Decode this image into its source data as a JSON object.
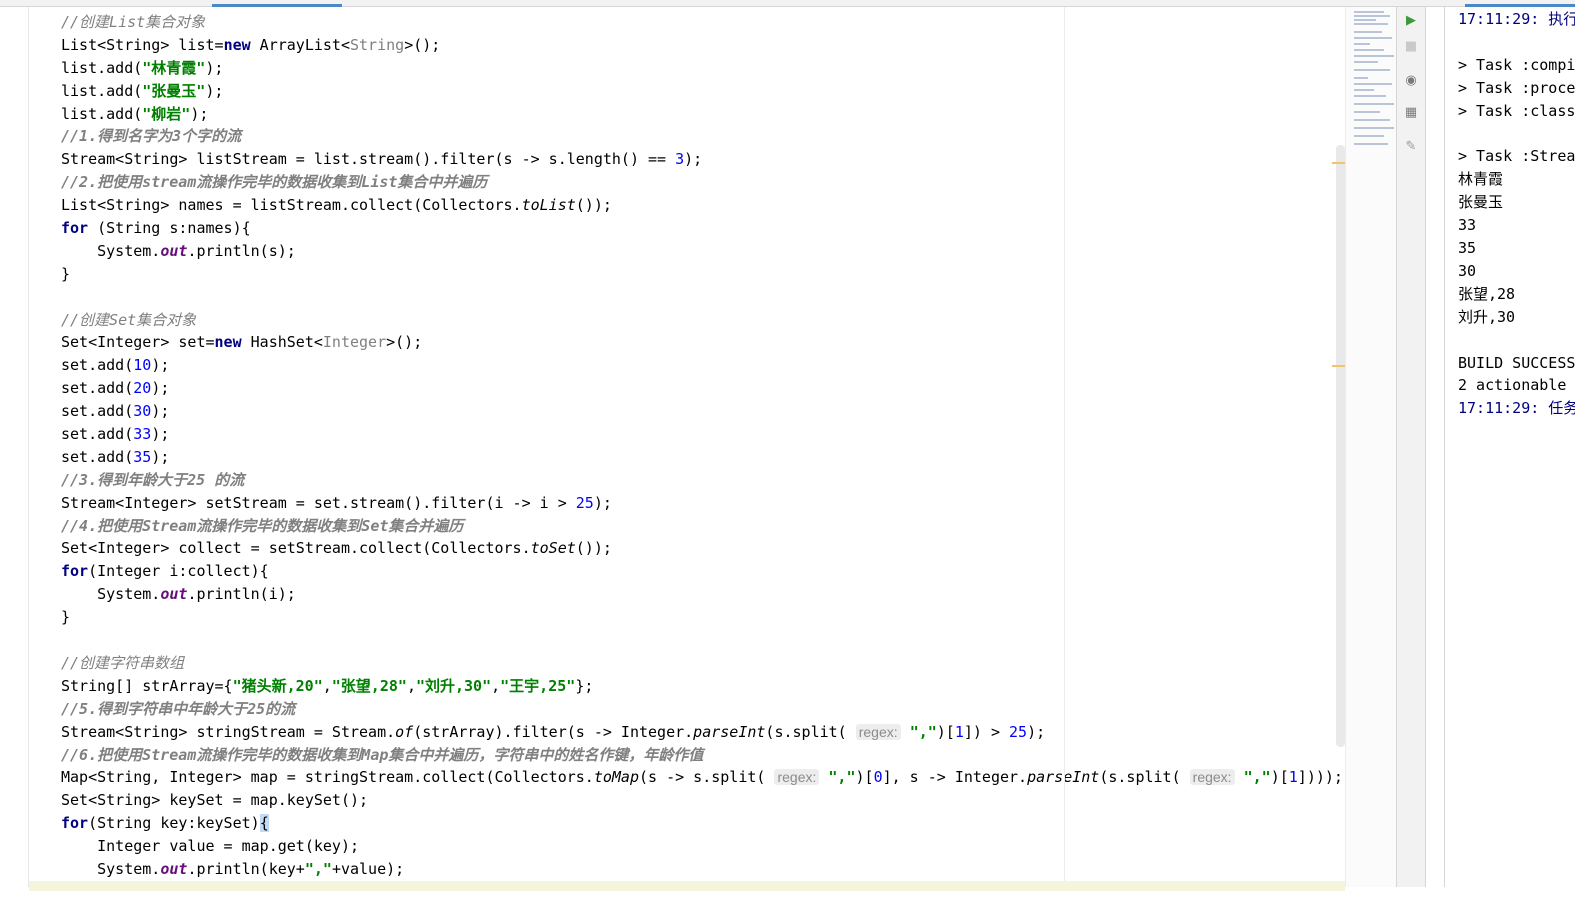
{
  "editor": {
    "lines": [
      {
        "s": [
          {
            "t": "//创建List集合对象",
            "c": "cm"
          }
        ]
      },
      {
        "s": [
          {
            "t": "List<String> list="
          },
          {
            "t": "new",
            "c": "kw"
          },
          {
            "t": " ArrayList<"
          },
          {
            "t": "String",
            "c": "gen"
          },
          {
            "t": ">();"
          }
        ]
      },
      {
        "s": [
          {
            "t": "list.add("
          },
          {
            "t": "\"林青霞\"",
            "c": "str"
          },
          {
            "t": ");"
          }
        ]
      },
      {
        "s": [
          {
            "t": "list.add("
          },
          {
            "t": "\"张曼玉\"",
            "c": "str"
          },
          {
            "t": ");"
          }
        ]
      },
      {
        "s": [
          {
            "t": "list.add("
          },
          {
            "t": "\"柳岩\"",
            "c": "str"
          },
          {
            "t": ");"
          }
        ]
      },
      {
        "s": [
          {
            "t": "//1.得到名字为3个字的流",
            "c": "cmb"
          }
        ]
      },
      {
        "s": [
          {
            "t": "Stream<String> listStream = list.stream().filter(s -> s.length() == "
          },
          {
            "t": "3",
            "c": "num"
          },
          {
            "t": ");"
          }
        ]
      },
      {
        "s": [
          {
            "t": "//2.把使用stream流操作完毕的数据收集到List集合中并遍历",
            "c": "cmb"
          }
        ]
      },
      {
        "s": [
          {
            "t": "List<String> names = listStream.collect(Collectors."
          },
          {
            "t": "toList",
            "c": "it"
          },
          {
            "t": "());"
          }
        ]
      },
      {
        "s": [
          {
            "t": "for",
            "c": "kw"
          },
          {
            "t": " (String s:names){"
          }
        ]
      },
      {
        "s": [
          {
            "t": "    System."
          },
          {
            "t": "out",
            "c": "stat"
          },
          {
            "t": ".println(s);"
          }
        ]
      },
      {
        "s": [
          {
            "t": "}"
          }
        ]
      },
      {
        "s": []
      },
      {
        "s": [
          {
            "t": "//创建Set集合对象",
            "c": "cm"
          }
        ]
      },
      {
        "s": [
          {
            "t": "Set<Integer> set="
          },
          {
            "t": "new",
            "c": "kw"
          },
          {
            "t": " HashSet<"
          },
          {
            "t": "Integer",
            "c": "gen"
          },
          {
            "t": ">();"
          }
        ]
      },
      {
        "s": [
          {
            "t": "set.add("
          },
          {
            "t": "10",
            "c": "num"
          },
          {
            "t": ");"
          }
        ]
      },
      {
        "s": [
          {
            "t": "set.add("
          },
          {
            "t": "20",
            "c": "num"
          },
          {
            "t": ");"
          }
        ]
      },
      {
        "s": [
          {
            "t": "set.add("
          },
          {
            "t": "30",
            "c": "num"
          },
          {
            "t": ");"
          }
        ]
      },
      {
        "s": [
          {
            "t": "set.add("
          },
          {
            "t": "33",
            "c": "num"
          },
          {
            "t": ");"
          }
        ]
      },
      {
        "s": [
          {
            "t": "set.add("
          },
          {
            "t": "35",
            "c": "num"
          },
          {
            "t": ");"
          }
        ]
      },
      {
        "s": [
          {
            "t": "//3.得到年龄大于25 的流",
            "c": "cmb"
          }
        ]
      },
      {
        "s": [
          {
            "t": "Stream<Integer> setStream = set.stream().filter(i -> i > "
          },
          {
            "t": "25",
            "c": "num"
          },
          {
            "t": ");"
          }
        ]
      },
      {
        "s": [
          {
            "t": "//4.把使用Stream流操作完毕的数据收集到Set集合并遍历",
            "c": "cmb"
          }
        ]
      },
      {
        "s": [
          {
            "t": "Set<Integer> collect = setStream.collect(Collectors."
          },
          {
            "t": "toSet",
            "c": "it"
          },
          {
            "t": "());"
          }
        ]
      },
      {
        "s": [
          {
            "t": "for",
            "c": "kw"
          },
          {
            "t": "(Integer i:collect){"
          }
        ]
      },
      {
        "s": [
          {
            "t": "    System."
          },
          {
            "t": "out",
            "c": "stat"
          },
          {
            "t": ".println(i);"
          }
        ]
      },
      {
        "s": [
          {
            "t": "}"
          }
        ]
      },
      {
        "s": []
      },
      {
        "s": [
          {
            "t": "//创建字符串数组",
            "c": "cm"
          }
        ]
      },
      {
        "s": [
          {
            "t": "String[] strArray={"
          },
          {
            "t": "\"猪头新,20\"",
            "c": "str"
          },
          {
            "t": ","
          },
          {
            "t": "\"张望,28\"",
            "c": "str"
          },
          {
            "t": ","
          },
          {
            "t": "\"刘升,30\"",
            "c": "str"
          },
          {
            "t": ","
          },
          {
            "t": "\"王宇,25\"",
            "c": "str"
          },
          {
            "t": "};"
          }
        ]
      },
      {
        "s": [
          {
            "t": "//5.得到字符串中年龄大于25的流",
            "c": "cmb"
          }
        ]
      },
      {
        "s": [
          {
            "t": "Stream<String> stringStream = Stream."
          },
          {
            "t": "of",
            "c": "it"
          },
          {
            "t": "(strArray).filter(s -> Integer."
          },
          {
            "t": "parseInt",
            "c": "it"
          },
          {
            "t": "(s.split( "
          },
          {
            "t": "regex:",
            "c": "hint"
          },
          {
            "t": " "
          },
          {
            "t": "\",\"",
            "c": "str"
          },
          {
            "t": ")["
          },
          {
            "t": "1",
            "c": "num"
          },
          {
            "t": "]) > "
          },
          {
            "t": "25",
            "c": "num"
          },
          {
            "t": ");"
          }
        ]
      },
      {
        "s": [
          {
            "t": "//6.把使用Stream流操作完毕的数据收集到Map集合中并遍历，字符串中的姓名作键，年龄作值",
            "c": "cmb"
          }
        ]
      },
      {
        "s": [
          {
            "t": "Map<String, Integer> map = stringStream.collect(Collectors."
          },
          {
            "t": "toMap",
            "c": "it"
          },
          {
            "t": "(s -> s.split( "
          },
          {
            "t": "regex:",
            "c": "hint"
          },
          {
            "t": " "
          },
          {
            "t": "\",\"",
            "c": "str"
          },
          {
            "t": ")["
          },
          {
            "t": "0",
            "c": "num"
          },
          {
            "t": "], s -> Integer."
          },
          {
            "t": "parseInt",
            "c": "it"
          },
          {
            "t": "(s.split( "
          },
          {
            "t": "regex:",
            "c": "hint"
          },
          {
            "t": " "
          },
          {
            "t": "\",\"",
            "c": "str"
          },
          {
            "t": ")["
          },
          {
            "t": "1",
            "c": "num"
          },
          {
            "t": "])));"
          }
        ]
      },
      {
        "s": [
          {
            "t": "Set<String> keySet = map.keySet();"
          }
        ]
      },
      {
        "s": [
          {
            "t": "for",
            "c": "kw"
          },
          {
            "t": "(String key:keySet)"
          },
          {
            "t": "{",
            "c": "brace-hl"
          }
        ]
      },
      {
        "s": [
          {
            "t": "    Integer value = map.get(key);"
          }
        ]
      },
      {
        "s": [
          {
            "t": "    System."
          },
          {
            "t": "out",
            "c": "stat"
          },
          {
            "t": ".println(key+"
          },
          {
            "t": "\",\"",
            "c": "str"
          },
          {
            "t": "+value);"
          }
        ]
      }
    ]
  },
  "console": {
    "lines": [
      {
        "t": "17:11:29: 执行",
        "c": "time"
      },
      {
        "t": ""
      },
      {
        "t": "> Task :compi"
      },
      {
        "t": "> Task :proce"
      },
      {
        "t": "> Task :class"
      },
      {
        "t": ""
      },
      {
        "t": "> Task :Strea"
      },
      {
        "t": "林青霞"
      },
      {
        "t": "张曼玉"
      },
      {
        "t": "33"
      },
      {
        "t": "35"
      },
      {
        "t": "30"
      },
      {
        "t": "张望,28"
      },
      {
        "t": "刘升,30"
      },
      {
        "t": ""
      },
      {
        "t": "BUILD SUCCESS"
      },
      {
        "t": "2 actionable"
      },
      {
        "t": "17:11:29: 任务",
        "c": "time"
      }
    ]
  },
  "toolbar": {
    "icons": [
      {
        "name": "run-icon",
        "glyph": "▶",
        "color": "#3c9a3c"
      },
      {
        "name": "stop-icon",
        "glyph": "■",
        "color": "#c9c9c9"
      },
      {
        "name": "eye-icon",
        "glyph": "◉",
        "color": "#7a7a7a"
      },
      {
        "name": "layout-icon",
        "glyph": "▦",
        "color": "#7a7a7a"
      },
      {
        "name": "pin-icon",
        "glyph": "✎",
        "color": "#9a9a9a"
      }
    ]
  },
  "colors": {
    "keyword": "#000080",
    "string": "#008000",
    "number": "#0000ff",
    "comment": "#808080",
    "static_field": "#660e7a",
    "console_time": "#00007f",
    "marker": "#f0c36d"
  }
}
